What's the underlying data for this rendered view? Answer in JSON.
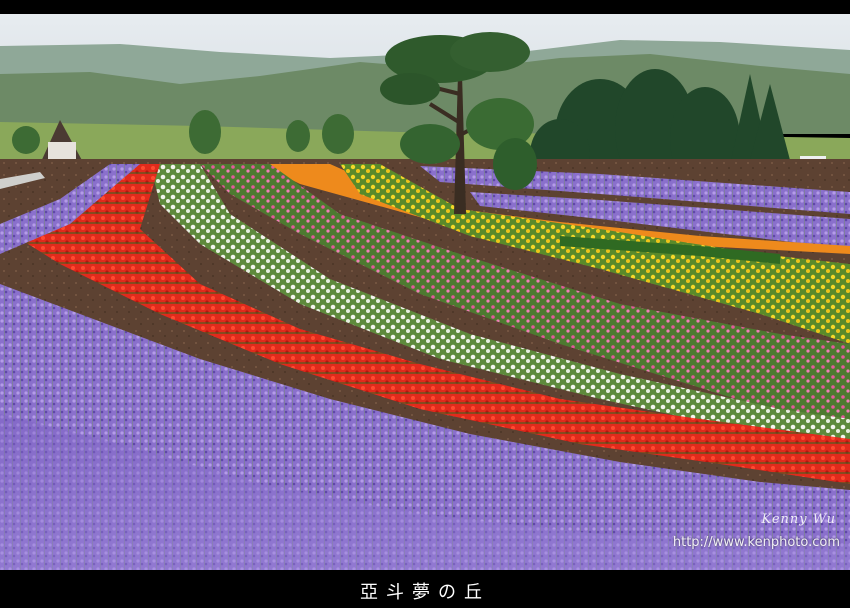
{
  "photo": {
    "subject": "flower-field",
    "colors": {
      "sky": "#dfe5ea",
      "mountain": "#6e8a6a",
      "lavender": "#8a6fcf",
      "red_salvia": "#e5231b",
      "white_flowers": "#f2f2ee",
      "yellow_flowers": "#f2d22a",
      "orange_flowers": "#f08a1c",
      "pink_flowers": "#e35a9a",
      "foliage": "#3d7a2a",
      "soil": "#5a3d2e"
    }
  },
  "watermark": {
    "signature": "Kenny Wu",
    "url": "http://www.kenphoto.com"
  },
  "caption": "亞斗夢の丘"
}
